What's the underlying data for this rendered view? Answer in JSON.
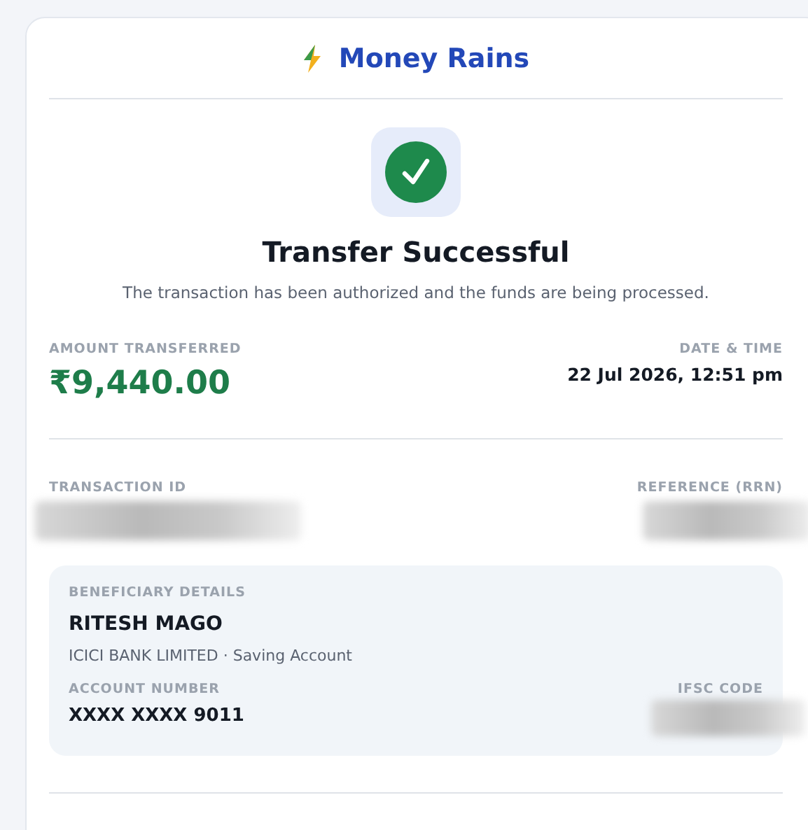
{
  "header": {
    "brand": "Money Rains"
  },
  "status": {
    "title": "Transfer Successful",
    "message": "The transaction has been authorized and the funds are being processed."
  },
  "amount": {
    "label": "AMOUNT TRANSFERRED",
    "value": "₹9,440.00"
  },
  "datetime": {
    "label": "DATE & TIME",
    "value": "22 Jul 2026, 12:51 pm"
  },
  "transaction_id": {
    "label": "TRANSACTION ID",
    "redacted": true
  },
  "reference": {
    "label": "REFERENCE (RRN)",
    "redacted": true
  },
  "beneficiary": {
    "heading": "BENEFICIARY DETAILS",
    "name": "RITESH MAGO",
    "bank": "ICICI BANK LIMITED · Saving Account",
    "account_label": "ACCOUNT NUMBER",
    "account_number": "XXXX XXXX 9011",
    "ifsc_label": "IFSC CODE",
    "ifsc_redacted": true
  }
}
